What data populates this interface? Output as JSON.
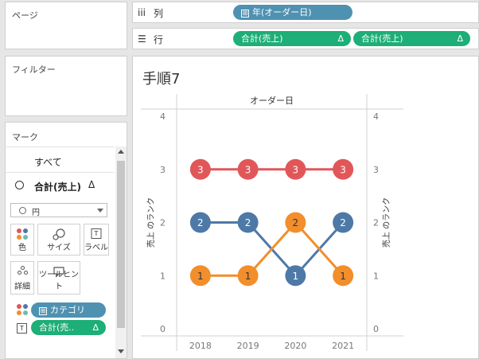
{
  "pages": {
    "title": "ページ"
  },
  "filters": {
    "title": "フィルター"
  },
  "marks": {
    "title": "マーク",
    "all_label": "すべて",
    "measure_label": "合計(売上)",
    "measure_delta": "Δ",
    "mark_type": "円",
    "buttons": {
      "color": "色",
      "size": "サイズ",
      "label": "ラベル",
      "detail": "詳細",
      "tooltip": "ツールヒント"
    },
    "fields": [
      {
        "role": "color",
        "name": "カテゴリ",
        "prefix": "⊞"
      },
      {
        "role": "label",
        "name": "合計(売..",
        "delta": "Δ"
      }
    ]
  },
  "shelves": {
    "columns": {
      "icon": "iii",
      "label": "列",
      "pill": {
        "prefix": "⊞",
        "text": "年(オーダー日)"
      }
    },
    "rows": {
      "icon": "☰",
      "label": "行",
      "pills": [
        {
          "text": "合計(売上)",
          "delta": "Δ"
        },
        {
          "text": "合計(売上)",
          "delta": "Δ"
        }
      ]
    }
  },
  "sheet": {
    "title": "手順7"
  },
  "colors": {
    "red": "#e15759",
    "blue": "#4e79a7",
    "orange": "#f28e2b",
    "pill_blue": "#4f91b1",
    "pill_green": "#1eae77"
  },
  "chart_data": {
    "type": "line",
    "header": "オーダー日",
    "x": [
      "2018",
      "2019",
      "2020",
      "2021"
    ],
    "ylabel_left": "売上 のランク",
    "ylabel_right": "売上 のランク",
    "yticks": [
      "0",
      "1",
      "2",
      "3",
      "4"
    ],
    "ylim": [
      0,
      4
    ],
    "series": [
      {
        "color": "#e15759",
        "values": [
          3,
          3,
          3,
          3
        ]
      },
      {
        "color": "#4e79a7",
        "values": [
          2,
          2,
          1,
          2
        ]
      },
      {
        "color": "#f28e2b",
        "values": [
          1,
          1,
          2,
          1
        ]
      }
    ]
  }
}
